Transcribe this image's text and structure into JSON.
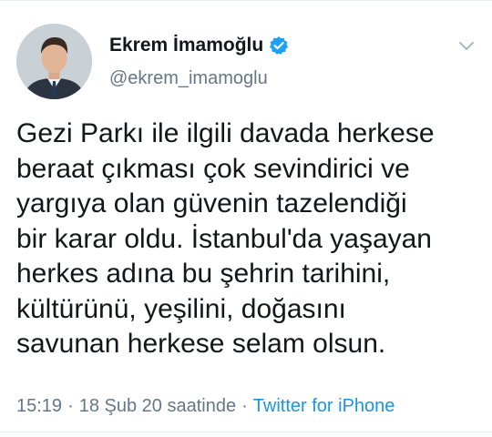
{
  "tweet": {
    "author": {
      "display_name": "Ekrem İmamoğlu",
      "handle": "@ekrem_imamoglu",
      "verified": true,
      "avatar_icon": "profile-photo"
    },
    "text_lines": [
      "Gezi Parkı ile ilgili davada herkese",
      "beraat çıkması çok sevindirici ve",
      "yargıya olan güvenin tazelendiği",
      "bir karar oldu. İstanbul'da yaşayan",
      "herkes adına bu şehrin tarihini,",
      "kültürünü, yeşilini, doğasını",
      "savunan herkese selam olsun."
    ],
    "meta": {
      "time": "15:19",
      "separator": "·",
      "date": "18 Şub 20 saatinde",
      "source": "Twitter for iPhone"
    }
  },
  "icons": {
    "verified": "verified-badge-icon",
    "menu": "chevron-down-icon"
  },
  "colors": {
    "primary_text": "#14171a",
    "secondary_text": "#657786",
    "link": "#1b95e0",
    "verified_badge": "#1da1f2",
    "divider": "#e6ecf0"
  }
}
